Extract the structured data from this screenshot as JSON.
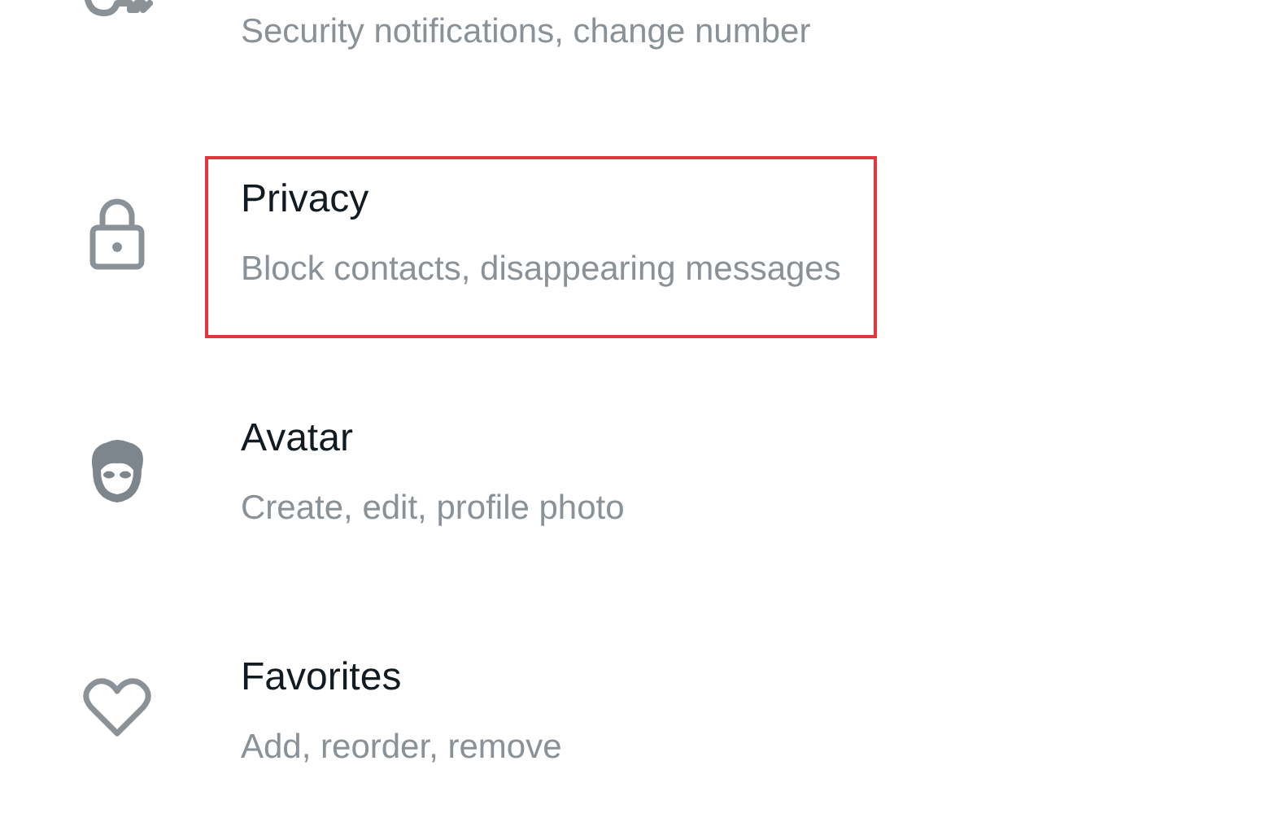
{
  "settings_items": [
    {
      "subtitle": "Security notifications, change number",
      "highlighted": false
    },
    {
      "title": "Privacy",
      "subtitle": "Block contacts, disappearing messages",
      "highlighted": true
    },
    {
      "title": "Avatar",
      "subtitle": "Create, edit, profile photo",
      "highlighted": false
    },
    {
      "title": "Favorites",
      "subtitle": "Add, reorder, remove",
      "highlighted": false
    }
  ]
}
